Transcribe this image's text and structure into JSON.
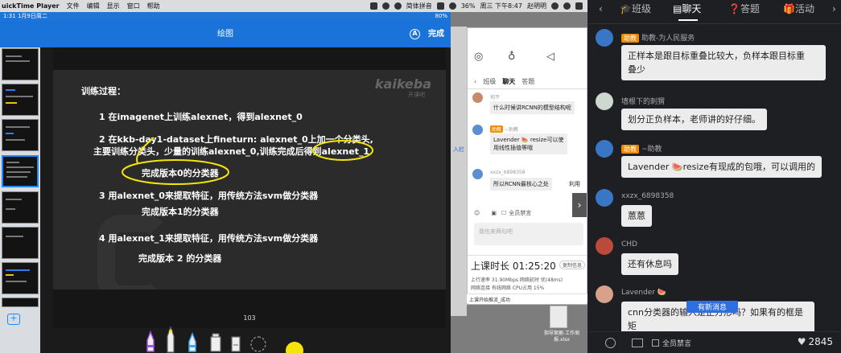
{
  "menubar": {
    "app_name": "uickTime Player",
    "items": [
      "文件",
      "编辑",
      "显示",
      "窗口",
      "帮助"
    ],
    "input_method": "简体拼音",
    "battery": "36%",
    "datetime": "周三 下午8:47",
    "user": "赵明明"
  },
  "statusbar": {
    "left": "1:31  1月9日周二",
    "right": "80%"
  },
  "drawbar": {
    "title": "绘图",
    "a_button": "A",
    "done": "完成"
  },
  "slide": {
    "logo": "kaikeba",
    "logo_sub": "开课吧",
    "heading": "训练过程：",
    "line1": "1 在imagenet上训练alexnet，得到alexnet_0",
    "line2a": "2 在kkb-day1-dataset上fineturn: alexnet_0上加一个分类头,",
    "line2b": "主要训练分类头，少量的训练alexnet_0,训练完成后得到alexnet_1",
    "line2c": "完成版本0的分类器",
    "line3a": "3 用alexnet_0来提取特征，用传统方法svm做分类器",
    "line3b": "完成版本1的分类器",
    "line4a": "4 用alexnet_1来提取特征，用传统方法svm做分类器",
    "line4b": "完成版本 2 的分类器",
    "page": "103"
  },
  "annotation_color": "#f4e40a",
  "mid": {
    "side_tag": "入栏",
    "tabs": [
      "班级",
      "聊天",
      "答题"
    ],
    "messages": [
      {
        "name": "何不",
        "text": "什么时候讲RCNN的模型结构呢"
      },
      {
        "badge": "助教",
        "name": "~助教",
        "text": "Lavender 🍉 resize可以使用线性插值等哦"
      },
      {
        "name": "xxzx_6898358",
        "text": "所以RCNN最核心之处"
      },
      {
        "name": "",
        "text": "利用"
      }
    ],
    "mute_label": "全员禁言",
    "input_placeholder": "我也来两句吧",
    "duration_label": "上课时长",
    "duration": "01:25:20",
    "copy_label": "复制信息",
    "stats_row1": "上行速率  31.90Mbps      网络延时  优(48ms)",
    "stats_row2": "网络连接  有线网络          CPU占用  15%",
    "status": "上课开始推流_成功",
    "file_label": "指导案据-工作周报.xlsx"
  },
  "chat": {
    "tabs": [
      "班级",
      "聊天",
      "答题",
      "活动"
    ],
    "messages": [
      {
        "badge": "助教",
        "name": "助教-为人民服务",
        "text_lines": [
          "正样本是跟目标重叠比较大，负样本跟目标重",
          "叠少"
        ]
      },
      {
        "name": "墙根下的刺猬",
        "text_lines": [
          "划分正负样本，老师讲的好仔细。"
        ]
      },
      {
        "badge": "助教",
        "name": "~助教",
        "text_lines": [
          "Lavender 🍉resize有现成的包哦，可以调用的"
        ]
      },
      {
        "name": "xxzx_6898358",
        "text_lines": [
          "蒽蒽"
        ]
      },
      {
        "name": "CHD",
        "text_lines": [
          "还有休息吗"
        ]
      },
      {
        "name": "Lavender 🍉",
        "text_lines": [
          "cnn分类器的输入是正方形吗？如果有的框是矩"
        ]
      }
    ],
    "new_messages": "有新消息",
    "mute_label": "全员禁言",
    "likes": "2845"
  }
}
